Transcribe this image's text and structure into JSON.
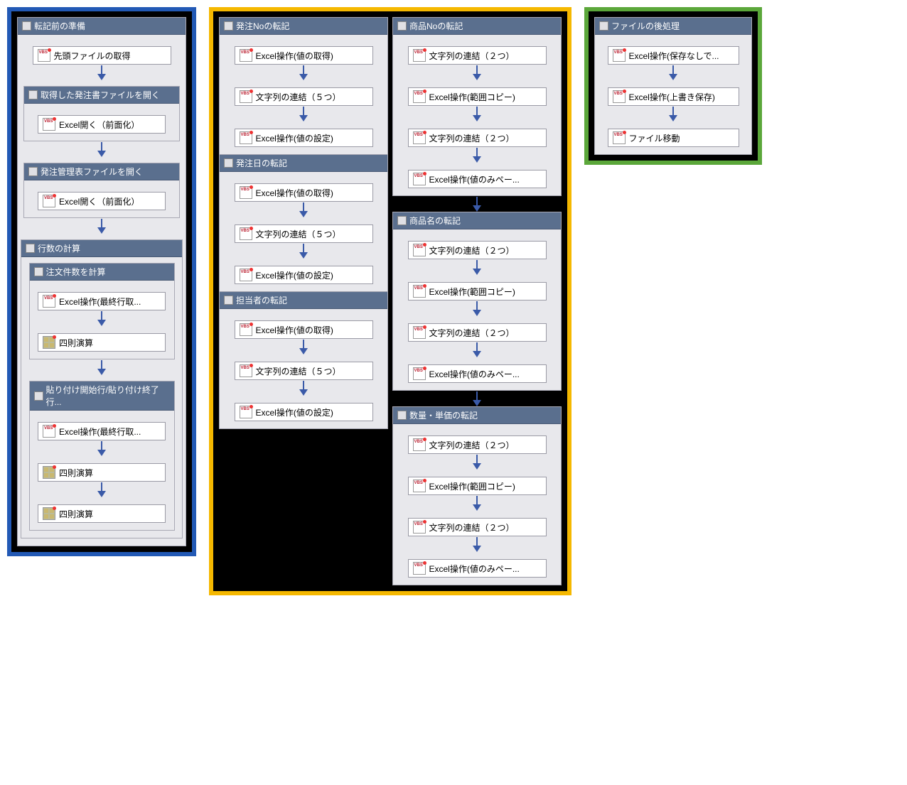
{
  "frame1": {
    "group1": {
      "title": "転記前の準備",
      "node1": "先頭ファイルの取得",
      "sub1": {
        "title": "取得した発注書ファイルを開く",
        "node1": "Excel開く（前面化）"
      },
      "sub2": {
        "title": "発注管理表ファイルを開く",
        "node1": "Excel開く（前面化）"
      },
      "sub3": {
        "title": "行数の計算",
        "sub1": {
          "title": "注文件数を計算",
          "node1": "Excel操作(最終行取...",
          "node2": "四則演算"
        },
        "sub2": {
          "title": "貼り付け開始行/貼り付け終了行...",
          "node1": "Excel操作(最終行取...",
          "node2": "四則演算",
          "node3": "四則演算"
        }
      }
    }
  },
  "frame2": {
    "colA": {
      "g1": {
        "title": "発注Noの転記",
        "n1": "Excel操作(値の取得)",
        "n2": "文字列の連結（５つ）",
        "n3": "Excel操作(値の設定)"
      },
      "g2": {
        "title": "発注日の転記",
        "n1": "Excel操作(値の取得)",
        "n2": "文字列の連結（５つ）",
        "n3": "Excel操作(値の設定)"
      },
      "g3": {
        "title": "担当者の転記",
        "n1": "Excel操作(値の取得)",
        "n2": "文字列の連結（５つ）",
        "n3": "Excel操作(値の設定)"
      }
    },
    "colB": {
      "g1": {
        "title": "商品Noの転記",
        "n1": "文字列の連結（２つ）",
        "n2": "Excel操作(範囲コピー)",
        "n3": "文字列の連結（２つ）",
        "n4": "Excel操作(値のみペー..."
      },
      "g2": {
        "title": "商品名の転記",
        "n1": "文字列の連結（２つ）",
        "n2": "Excel操作(範囲コピー)",
        "n3": "文字列の連結（２つ）",
        "n4": "Excel操作(値のみペー..."
      },
      "g3": {
        "title": "数量・単価の転記",
        "n1": "文字列の連結（２つ）",
        "n2": "Excel操作(範囲コピー)",
        "n3": "文字列の連結（２つ）",
        "n4": "Excel操作(値のみペー..."
      }
    }
  },
  "frame3": {
    "g1": {
      "title": "ファイルの後処理",
      "n1": "Excel操作(保存なしで...",
      "n2": "Excel操作(上書き保存)",
      "n3": "ファイル移動"
    }
  }
}
